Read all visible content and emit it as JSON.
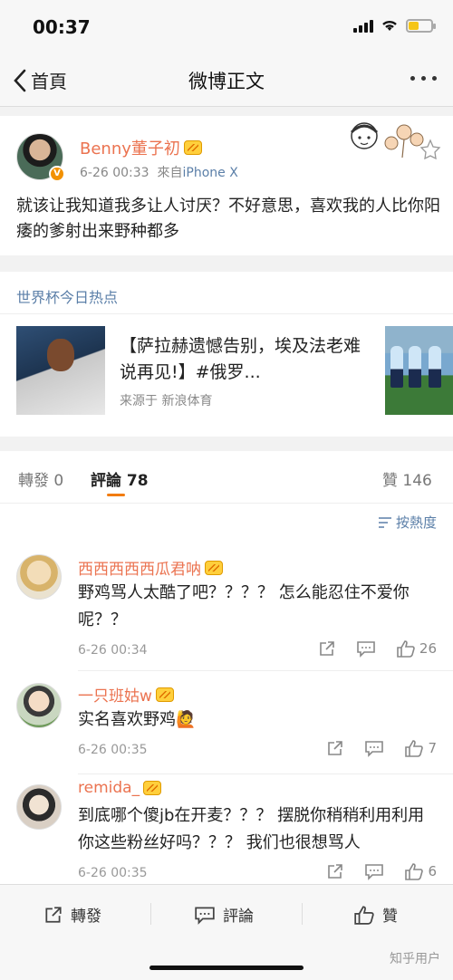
{
  "status": {
    "time": "00:37",
    "battery_level": 0.45
  },
  "nav": {
    "back_label": "首頁",
    "title": "微博正文"
  },
  "post": {
    "author": "Benny董子初",
    "time": "6-26 00:33",
    "source_prefix": "來自",
    "source": "iPhone X",
    "text": "就该让我知道我多让人讨厌？不好意思，喜欢我的人比你阳痿的爹射出来野种都多"
  },
  "topic": {
    "title": "世界杯今日热点",
    "headline": "【萨拉赫遗憾告别，埃及法老难说再见!】#俄罗...",
    "source": "来源于 新浪体育"
  },
  "tabs": {
    "repost_label": "轉發",
    "repost_count": "0",
    "comment_label": "評論",
    "comment_count": "78",
    "like_label": "贊",
    "like_count": "146"
  },
  "sort_label": "按熱度",
  "comments": [
    {
      "name": "西西西西西瓜君呐",
      "text": "野鸡骂人太酷了吧？？？？ 怎么能忍住不爱你呢？？",
      "time": "6-26 00:34",
      "likes": "26"
    },
    {
      "name": "一只班姑w",
      "text": "实名喜欢野鸡🙋",
      "time": "6-26 00:35",
      "likes": "7"
    },
    {
      "name": "remida_",
      "text": "到底哪个傻jb在开麦？？？ 摆脱你稍稍利用利用你这些粉丝好吗？？？ 我们也很想骂人",
      "time": "6-26 00:35",
      "likes": "6"
    }
  ],
  "bottom": {
    "repost_label": "轉發",
    "comment_label": "評論",
    "like_label": "贊"
  },
  "watermark": "知乎用户",
  "colors": {
    "name_orange": "#eb7350",
    "link_blue": "#5b7fa8",
    "accent": "#f27c0f"
  }
}
